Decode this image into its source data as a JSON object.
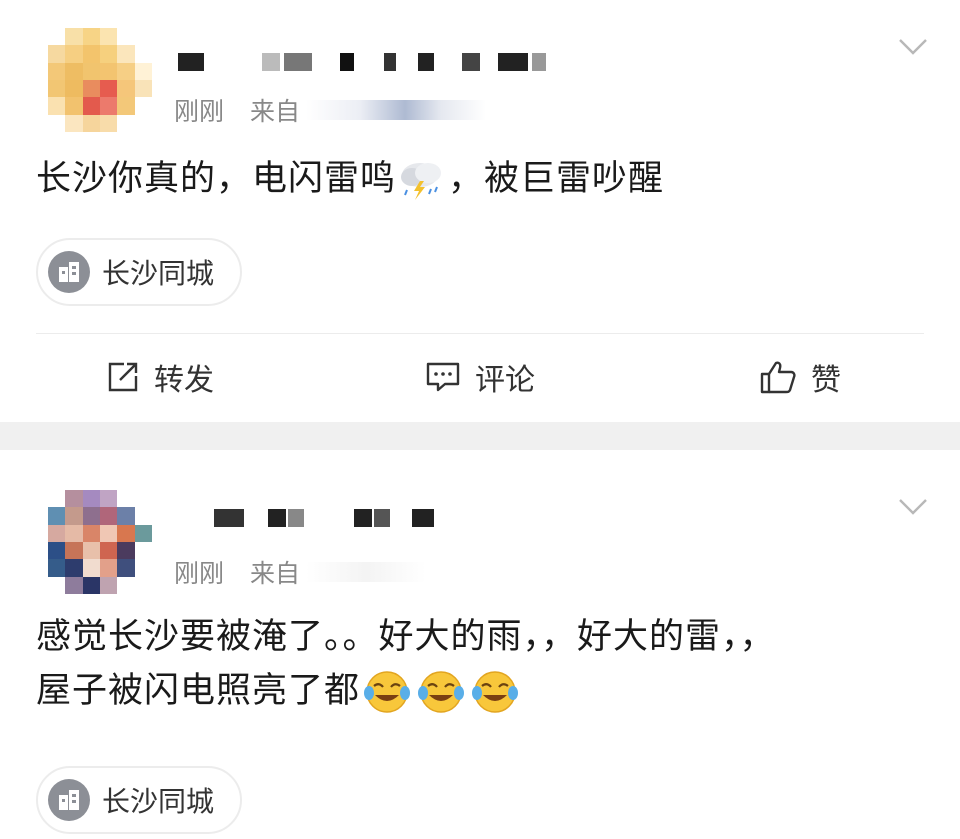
{
  "posts": [
    {
      "time": "刚刚",
      "source_prefix": "来自",
      "text_parts": [
        "长沙你真的，电闪雷鸣",
        "，被巨雷吵醒"
      ],
      "emojis": [
        "thunderstorm-emoji"
      ],
      "topic": "长沙同城",
      "actions": {
        "repost": "转发",
        "comment": "评论",
        "like": "赞"
      }
    },
    {
      "time": "刚刚",
      "source_prefix": "来自",
      "text_line1": "感觉长沙要被淹了。。好大的雨，，好大的雷，，",
      "text_line2": "屋子被闪电照亮了都",
      "emojis": [
        "crying-laugh-emoji",
        "crying-laugh-emoji",
        "crying-laugh-emoji"
      ],
      "topic": "长沙同城"
    }
  ],
  "colors": {
    "divider": "#ececec",
    "gap": "#f0f0f0",
    "meta": "#888888",
    "topic_icon": "#8c8f96"
  }
}
